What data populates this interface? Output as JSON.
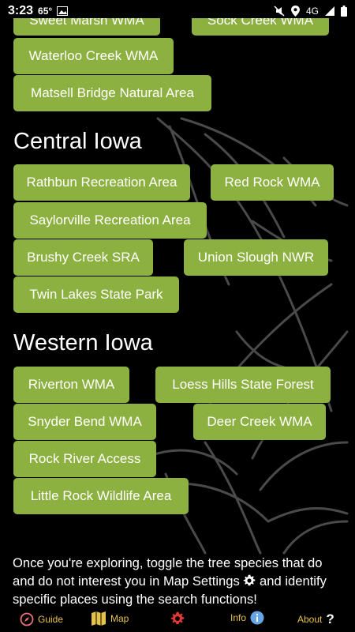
{
  "status_bar": {
    "time": "3:23",
    "temperature": "65°",
    "network": "4G"
  },
  "top_partial_chips": [
    "Sweet Marsh WMA",
    "Sock Creek WMA"
  ],
  "northeast_chips": [
    "Waterloo Creek WMA",
    "Matsell Bridge Natural Area"
  ],
  "central": {
    "title": "Central Iowa",
    "chips": [
      "Rathbun Recreation Area",
      "Red Rock WMA",
      "Saylorville Recreation Area",
      "Brushy Creek SRA",
      "Union Slough NWR",
      "Twin Lakes State Park"
    ]
  },
  "western": {
    "title": "Western Iowa",
    "chips": [
      "Riverton WMA",
      "Loess Hills State Forest",
      "Snyder Bend WMA",
      "Deer Creek WMA",
      "Rock River Access",
      "Little Rock Wildlife Area"
    ]
  },
  "info": {
    "part1": "Once you're exploring, toggle the tree species that do and do not interest you in Map Settings ",
    "part2": " and identify specific places using the search functions!"
  },
  "nav": {
    "guide": "Guide",
    "map": "Map",
    "info": "Info",
    "about": "About"
  },
  "colors": {
    "chip": "#8db140",
    "background": "#000000",
    "nav_label": "#e6c24a",
    "settings_icon": "#e53935"
  }
}
